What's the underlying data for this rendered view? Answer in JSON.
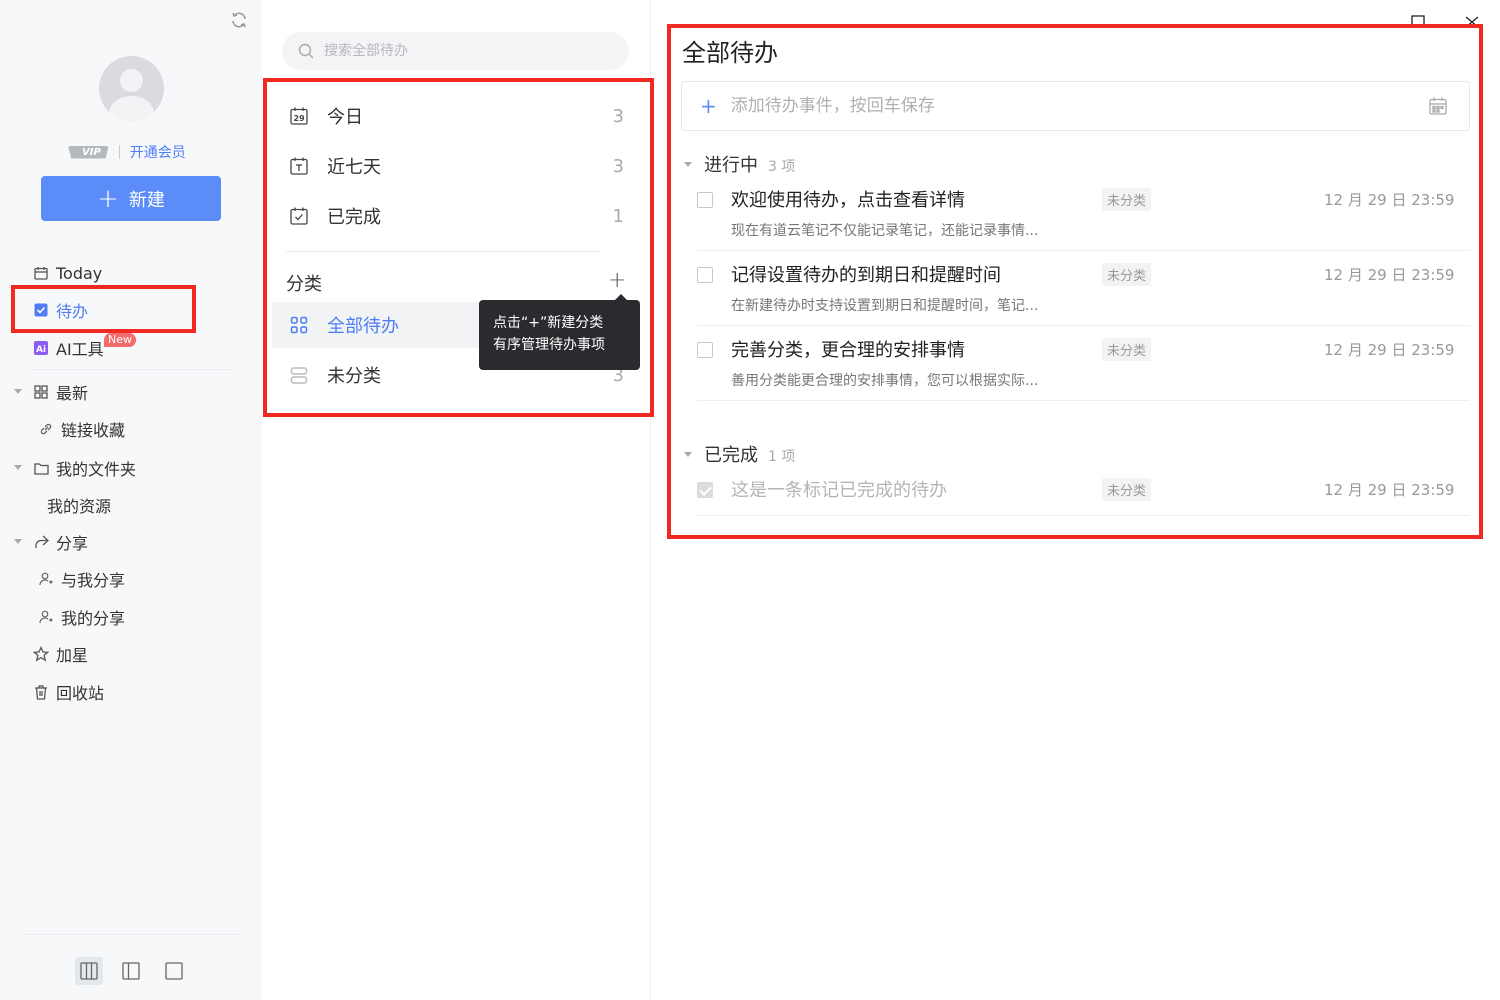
{
  "sidebar": {
    "vip_badge": "VIP",
    "vip_link": "开通会员",
    "new_button": "新建",
    "new_tag": "New",
    "items": [
      {
        "label": "Today",
        "icon": "calendar-icon"
      },
      {
        "label": "待办",
        "icon": "todo-check-icon",
        "active": true
      },
      {
        "label": "AI工具",
        "icon": "ai-icon"
      },
      {
        "label": "最新",
        "icon": "grid-icon"
      },
      {
        "label": "链接收藏",
        "icon": "link-icon"
      },
      {
        "label": "我的文件夹",
        "icon": "folder-icon"
      },
      {
        "label": "我的资源"
      },
      {
        "label": "分享",
        "icon": "share-icon"
      },
      {
        "label": "与我分享",
        "icon": "user-share-icon"
      },
      {
        "label": "我的分享",
        "icon": "user-share-icon"
      },
      {
        "label": "加星",
        "icon": "star-icon"
      },
      {
        "label": "回收站",
        "icon": "trash-icon"
      }
    ]
  },
  "middle": {
    "search_placeholder": "搜索全部待办",
    "filters": [
      {
        "label": "今日",
        "count": "3",
        "icon": "calendar-29-icon"
      },
      {
        "label": "近七天",
        "count": "3",
        "icon": "calendar-t-icon"
      },
      {
        "label": "已完成",
        "count": "1",
        "icon": "calendar-check-icon"
      }
    ],
    "category_title": "分类",
    "category_add": "+",
    "categories": [
      {
        "label": "全部待办",
        "icon": "grid-icon",
        "active": true
      },
      {
        "label": "未分类",
        "count": "3",
        "icon": "uncategorized-icon"
      }
    ],
    "tooltip": [
      "点击“+”新建分类",
      "有序管理待办事项"
    ]
  },
  "main": {
    "title": "全部待办",
    "add_placeholder": "添加待办事件，按回车保存",
    "groups": [
      {
        "name": "进行中",
        "count": "3 项"
      },
      {
        "name": "已完成",
        "count": "1 项"
      }
    ],
    "todos": [
      {
        "title": "欢迎使用待办，点击查看详情",
        "desc": "现在有道云笔记不仅能记录笔记，还能记录事情...",
        "tag": "未分类",
        "date": "12 月 29 日 23:59",
        "done": false
      },
      {
        "title": "记得设置待办的到期日和提醒时间",
        "desc": "在新建待办时支持设置到期日和提醒时间，笔记...",
        "tag": "未分类",
        "date": "12 月 29 日 23:59",
        "done": false
      },
      {
        "title": "完善分类，更合理的安排事情",
        "desc": "善用分类能更合理的安排事情，您可以根据实际...",
        "tag": "未分类",
        "date": "12 月 29 日 23:59",
        "done": false
      },
      {
        "title": "这是一条标记已完成的待办",
        "desc": "",
        "tag": "未分类",
        "date": "12 月 29 日 23:59",
        "done": true
      }
    ]
  },
  "colors": {
    "accent": "#5b8cf7",
    "highlight": "#f02a22",
    "tooltip_bg": "#2a2b2e"
  }
}
